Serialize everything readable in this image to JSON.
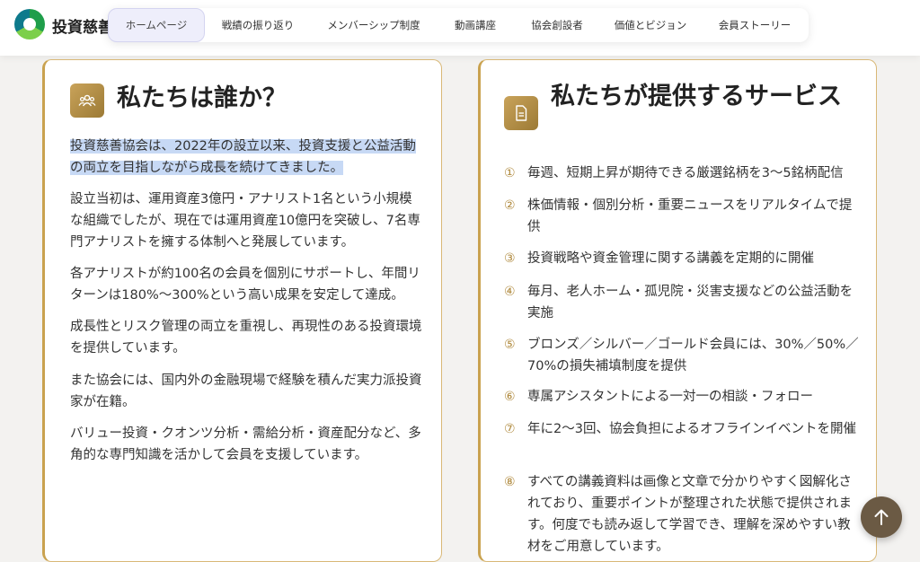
{
  "header": {
    "brand": "投資慈善",
    "logo_icon": "circular-leaf-logo",
    "nav": [
      {
        "label": "ホームページ",
        "active": true
      },
      {
        "label": "戦績の振り返り"
      },
      {
        "label": "メンバーシップ制度"
      },
      {
        "label": "動画講座"
      },
      {
        "label": "協会創設者"
      },
      {
        "label": "価値とビジョン"
      },
      {
        "label": "会員ストーリー"
      }
    ]
  },
  "who": {
    "icon": "people-group-icon",
    "title": "私たちは誰か？",
    "paragraphs": [
      "投資慈善協会は、2022年の設立以来、投資支援と公益活動の両立を目指しながら成長を続けてきました。",
      "設立当初は、運用資産3億円・アナリスト1名という小規模な組織でしたが、現在では運用資産10億円を突破し、7名専門アナリストを擁する体制へと発展しています。",
      "各アナリストが約100名の会員を個別にサポートし、年間リターンは180%〜300%という高い成果を安定して達成。",
      "成長性とリスク管理の両立を重視し、再現性のある投資環境を提供しています。",
      "また協会には、国内外の金融現場で経験を積んだ実力派投資家が在籍。",
      "バリュー投資・クオンツ分析・需給分析・資産配分など、多角的な専門知識を活かして会員を支援しています。"
    ]
  },
  "services": {
    "icon": "document-icon",
    "title": "私たちが提供するサービス",
    "items": [
      {
        "num": "①",
        "text": "毎週、短期上昇が期待できる厳選銘柄を3〜5銘柄配信"
      },
      {
        "num": "②",
        "text": "株価情報・個別分析・重要ニュースをリアルタイムで提供"
      },
      {
        "num": "③",
        "text": "投資戦略や資金管理に関する講義を定期的に開催"
      },
      {
        "num": "④",
        "text": "毎月、老人ホーム・孤児院・災害支援などの公益活動を実施"
      },
      {
        "num": "⑤",
        "text": "ブロンズ／シルバー／ゴールド会員には、30%／50%／70%の損失補填制度を提供"
      },
      {
        "num": "⑥",
        "text": "専属アシスタントによる一対一の相談・フォロー"
      },
      {
        "num": "⑦",
        "text": "年に2〜3回、協会負担によるオフラインイベントを開催"
      },
      {
        "num": "⑧",
        "text": "すべての講義資料は画像と文章で分かりやすく図解化されており、重要ポイントが整理された状態で提供されます。何度でも読み返して学習でき、理解を深めやすい教材をご用意しています。"
      }
    ]
  },
  "scroll_top": {
    "icon": "arrow-up-icon"
  },
  "colors": {
    "accent_gold": "#c9a24f",
    "nav_active_bg": "#eeeefb",
    "button_bg": "#6b5a44"
  }
}
